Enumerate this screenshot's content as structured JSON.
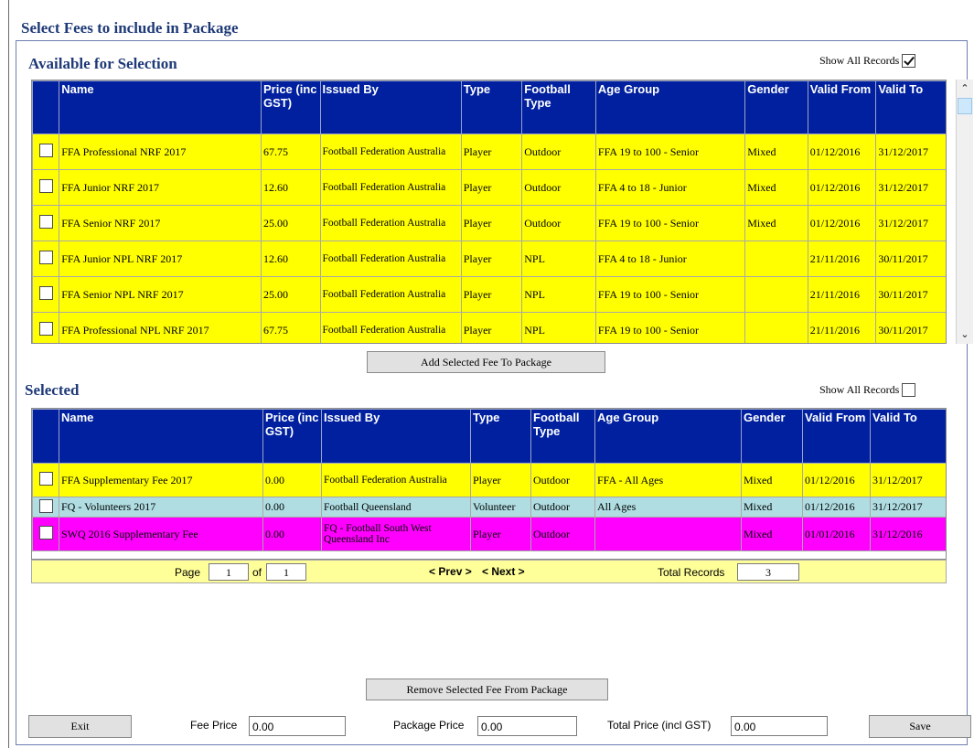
{
  "page_title": "Select Fees to include in Package",
  "available": {
    "title": "Available for Selection",
    "show_all_label": "Show All Records",
    "show_all_checked": true,
    "columns": [
      "",
      "Name",
      "Price (inc GST)",
      "Issued By",
      "Type",
      "Football Type",
      "Age Group",
      "Gender",
      "Valid From",
      "Valid To"
    ],
    "rows": [
      {
        "name": "FFA Professional NRF 2017",
        "price": "67.75",
        "issued_by": "Football Federation Australia",
        "type": "Player",
        "football_type": "Outdoor",
        "age_group": "FFA 19 to 100 - Senior",
        "gender": "Mixed",
        "valid_from": "01/12/2016",
        "valid_to": "31/12/2017",
        "color": "yellow"
      },
      {
        "name": "FFA Junior NRF 2017",
        "price": "12.60",
        "issued_by": "Football Federation Australia",
        "type": "Player",
        "football_type": "Outdoor",
        "age_group": "FFA 4 to 18 - Junior",
        "gender": "Mixed",
        "valid_from": "01/12/2016",
        "valid_to": "31/12/2017",
        "color": "yellow"
      },
      {
        "name": "FFA Senior NRF 2017",
        "price": "25.00",
        "issued_by": "Football Federation Australia",
        "type": "Player",
        "football_type": "Outdoor",
        "age_group": "FFA 19 to 100 - Senior",
        "gender": "Mixed",
        "valid_from": "01/12/2016",
        "valid_to": "31/12/2017",
        "color": "yellow"
      },
      {
        "name": "FFA Junior NPL NRF 2017",
        "price": "12.60",
        "issued_by": "Football Federation Australia",
        "type": "Player",
        "football_type": "NPL",
        "age_group": "FFA 4 to 18 - Junior",
        "gender": "",
        "valid_from": "21/11/2016",
        "valid_to": "30/11/2017",
        "color": "yellow"
      },
      {
        "name": "FFA Senior NPL NRF 2017",
        "price": "25.00",
        "issued_by": "Football Federation Australia",
        "type": "Player",
        "football_type": "NPL",
        "age_group": "FFA 19 to 100 - Senior",
        "gender": "",
        "valid_from": "21/11/2016",
        "valid_to": "30/11/2017",
        "color": "yellow"
      },
      {
        "name": "FFA Professional NPL NRF 2017",
        "price": "67.75",
        "issued_by": "Football Federation Australia",
        "type": "Player",
        "football_type": "NPL",
        "age_group": "FFA 19 to 100 - Senior",
        "gender": "",
        "valid_from": "21/11/2016",
        "valid_to": "30/11/2017",
        "color": "yellow"
      }
    ]
  },
  "add_button": "Add Selected Fee To Package",
  "selected": {
    "title": "Selected",
    "show_all_label": "Show All Records",
    "show_all_checked": false,
    "columns": [
      "",
      "Name",
      "Price (inc GST)",
      "Issued By",
      "Type",
      "Football Type",
      "Age Group",
      "Gender",
      "Valid From",
      "Valid To"
    ],
    "rows": [
      {
        "name": "FFA Supplementary Fee 2017",
        "price": "0.00",
        "issued_by": "Football Federation Australia",
        "type": "Player",
        "football_type": "Outdoor",
        "age_group": "FFA - All Ages",
        "gender": "Mixed",
        "valid_from": "01/12/2016",
        "valid_to": "31/12/2017",
        "color": "yellow"
      },
      {
        "name": "FQ - Volunteers 2017",
        "price": "0.00",
        "issued_by": "Football Queensland",
        "type": "Volunteer",
        "football_type": "Outdoor",
        "age_group": "All Ages",
        "gender": "Mixed",
        "valid_from": "01/12/2016",
        "valid_to": "31/12/2017",
        "color": "cyan"
      },
      {
        "name": "SWQ 2016 Supplementary Fee",
        "price": "0.00",
        "issued_by": "FQ - Football South West Queensland Inc",
        "type": "Player",
        "football_type": "Outdoor",
        "age_group": "",
        "gender": "Mixed",
        "valid_from": "01/01/2016",
        "valid_to": "31/12/2016",
        "color": "magenta"
      }
    ],
    "pager": {
      "page_label": "Page",
      "page_value": "1",
      "of_label": "of",
      "of_value": "1",
      "prev_label": "< Prev >",
      "next_label": "< Next >",
      "total_label": "Total Records",
      "total_value": "3"
    }
  },
  "remove_button": "Remove Selected Fee From Package",
  "footer": {
    "exit_label": "Exit",
    "fee_price_label": "Fee Price",
    "fee_price_value": "0.00",
    "package_price_label": "Package Price",
    "package_price_value": "0.00",
    "total_price_label": "Total Price (incl GST)",
    "total_price_value": "0.00",
    "save_label": "Save"
  },
  "colors": {
    "header_blue": "#00209f",
    "title_blue": "#1f3a78",
    "row_yellow": "#ffff00",
    "row_cyan": "#b0dde2",
    "row_magenta": "#ff00ff",
    "pager_yellow": "#ffff99"
  },
  "icons": [
    "scroll-up-icon",
    "scroll-down-icon",
    "checkbox-icon"
  ]
}
